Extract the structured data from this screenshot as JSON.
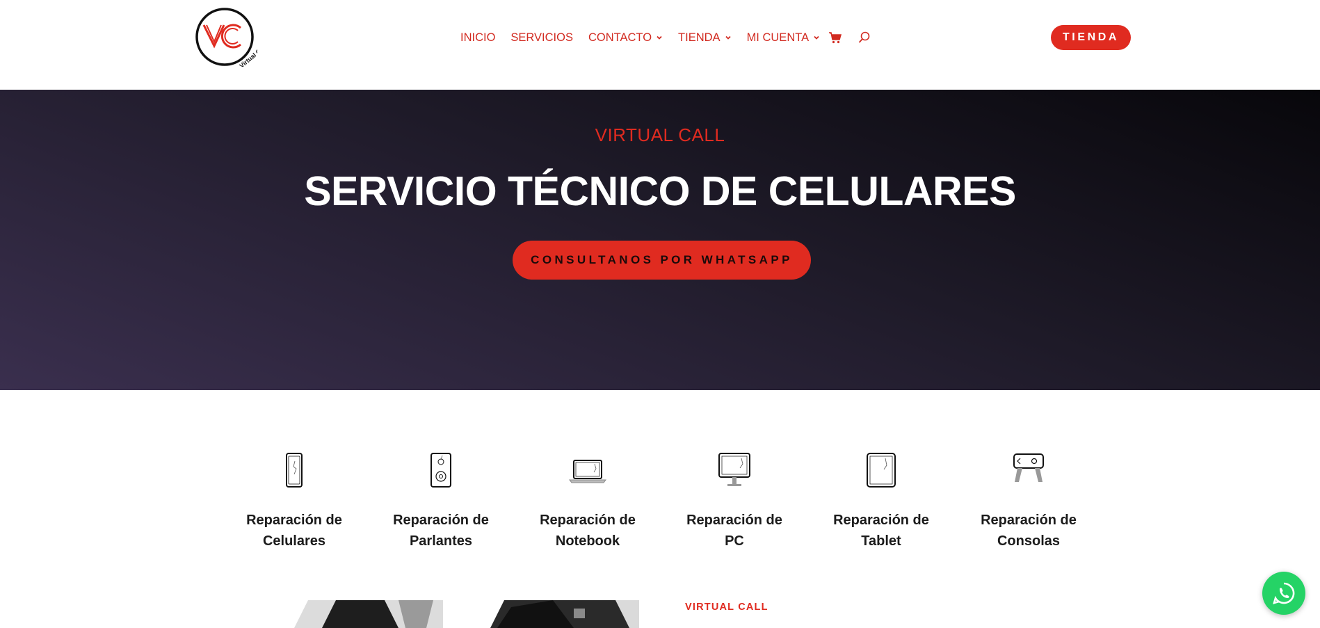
{
  "header": {
    "logo_text": "VC",
    "logo_ring_text": "Virtual Call",
    "nav": [
      {
        "label": "INICIO",
        "has_dropdown": false
      },
      {
        "label": "SERVICIOS",
        "has_dropdown": false
      },
      {
        "label": "CONTACTO",
        "has_dropdown": true
      },
      {
        "label": "TIENDA",
        "has_dropdown": true
      },
      {
        "label": "MI CUENTA",
        "has_dropdown": true
      }
    ],
    "cart_icon": "cart-icon",
    "search_icon": "search-icon",
    "cta_label": "TIENDA"
  },
  "hero": {
    "kicker": "VIRTUAL CALL",
    "title": "SERVICIO TÉCNICO DE CELULARES",
    "button_label": "CONSULTANOS POR WHATSAPP"
  },
  "services": [
    {
      "line1": "Reparación de",
      "line2": "Celulares",
      "icon": "phone-icon"
    },
    {
      "line1": "Reparación de",
      "line2": "Parlantes",
      "icon": "speaker-icon"
    },
    {
      "line1": "Reparación de",
      "line2": "Notebook",
      "icon": "laptop-icon"
    },
    {
      "line1": "Reparación de",
      "line2": "PC",
      "icon": "monitor-icon"
    },
    {
      "line1": "Reparación de",
      "line2": "Tablet",
      "icon": "tablet-icon"
    },
    {
      "line1": "Reparación de",
      "line2": "Consolas",
      "icon": "console-icon"
    }
  ],
  "next_section": {
    "kicker": "VIRTUAL CALL"
  },
  "floating": {
    "whatsapp_icon": "whatsapp-icon"
  },
  "colors": {
    "accent": "#e02b20",
    "nav_text": "#d22b21",
    "hero_dark": "#0b0a0f",
    "hero_purple": "#3a2f4e",
    "whatsapp": "#25d366"
  }
}
